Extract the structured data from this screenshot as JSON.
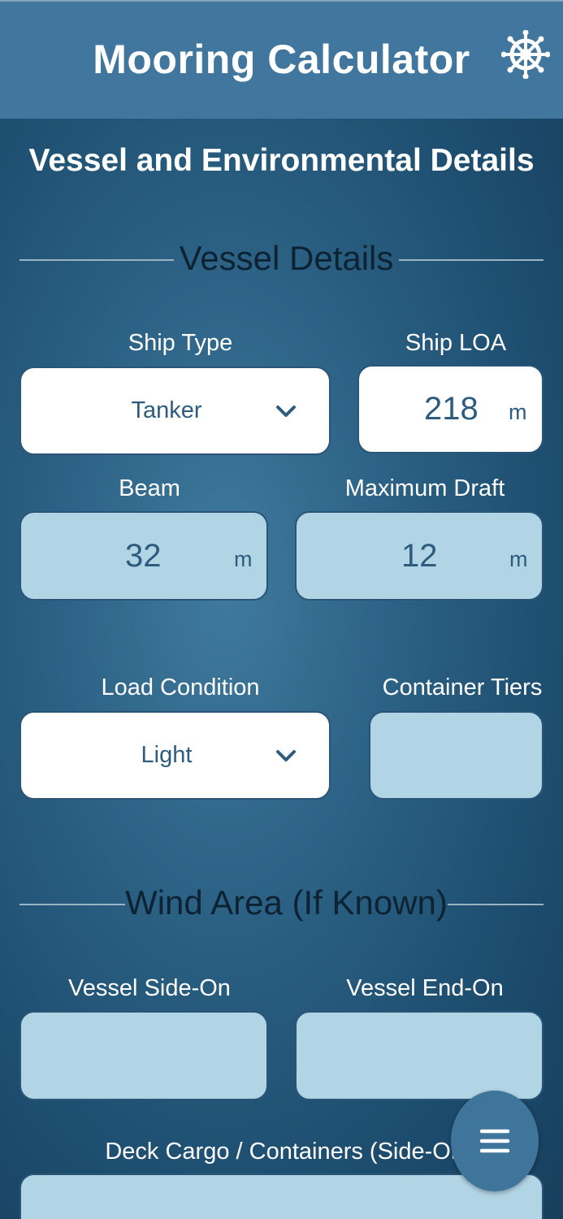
{
  "header": {
    "title": "Mooring Calculator",
    "settings_icon": "ship-wheel-icon"
  },
  "page": {
    "title": "Vessel and Environmental Details"
  },
  "vessel_details": {
    "heading": "Vessel Details",
    "ship_type": {
      "label": "Ship Type",
      "value": "Tanker"
    },
    "ship_loa": {
      "label": "Ship LOA",
      "value": "218",
      "unit": "m"
    },
    "beam": {
      "label": "Beam",
      "value": "32",
      "unit": "m"
    },
    "maximum_draft": {
      "label": "Maximum Draft",
      "value": "12",
      "unit": "m"
    },
    "load_condition": {
      "label": "Load Condition",
      "value": "Light"
    },
    "container_tiers": {
      "label": "Container Tiers",
      "value": ""
    }
  },
  "wind_area": {
    "heading": "Wind Area (If Known)",
    "vessel_side_on": {
      "label": "Vessel Side-On",
      "value": ""
    },
    "vessel_end_on": {
      "label": "Vessel End-On",
      "value": ""
    },
    "deck_cargo_side_on": {
      "label": "Deck Cargo / Containers (Side-On)",
      "value": ""
    }
  },
  "fab": {
    "icon": "menu-icon"
  },
  "colors": {
    "header": "#41769f",
    "input_light": "#b2d5e6",
    "input_text": "#2d5c7e"
  }
}
